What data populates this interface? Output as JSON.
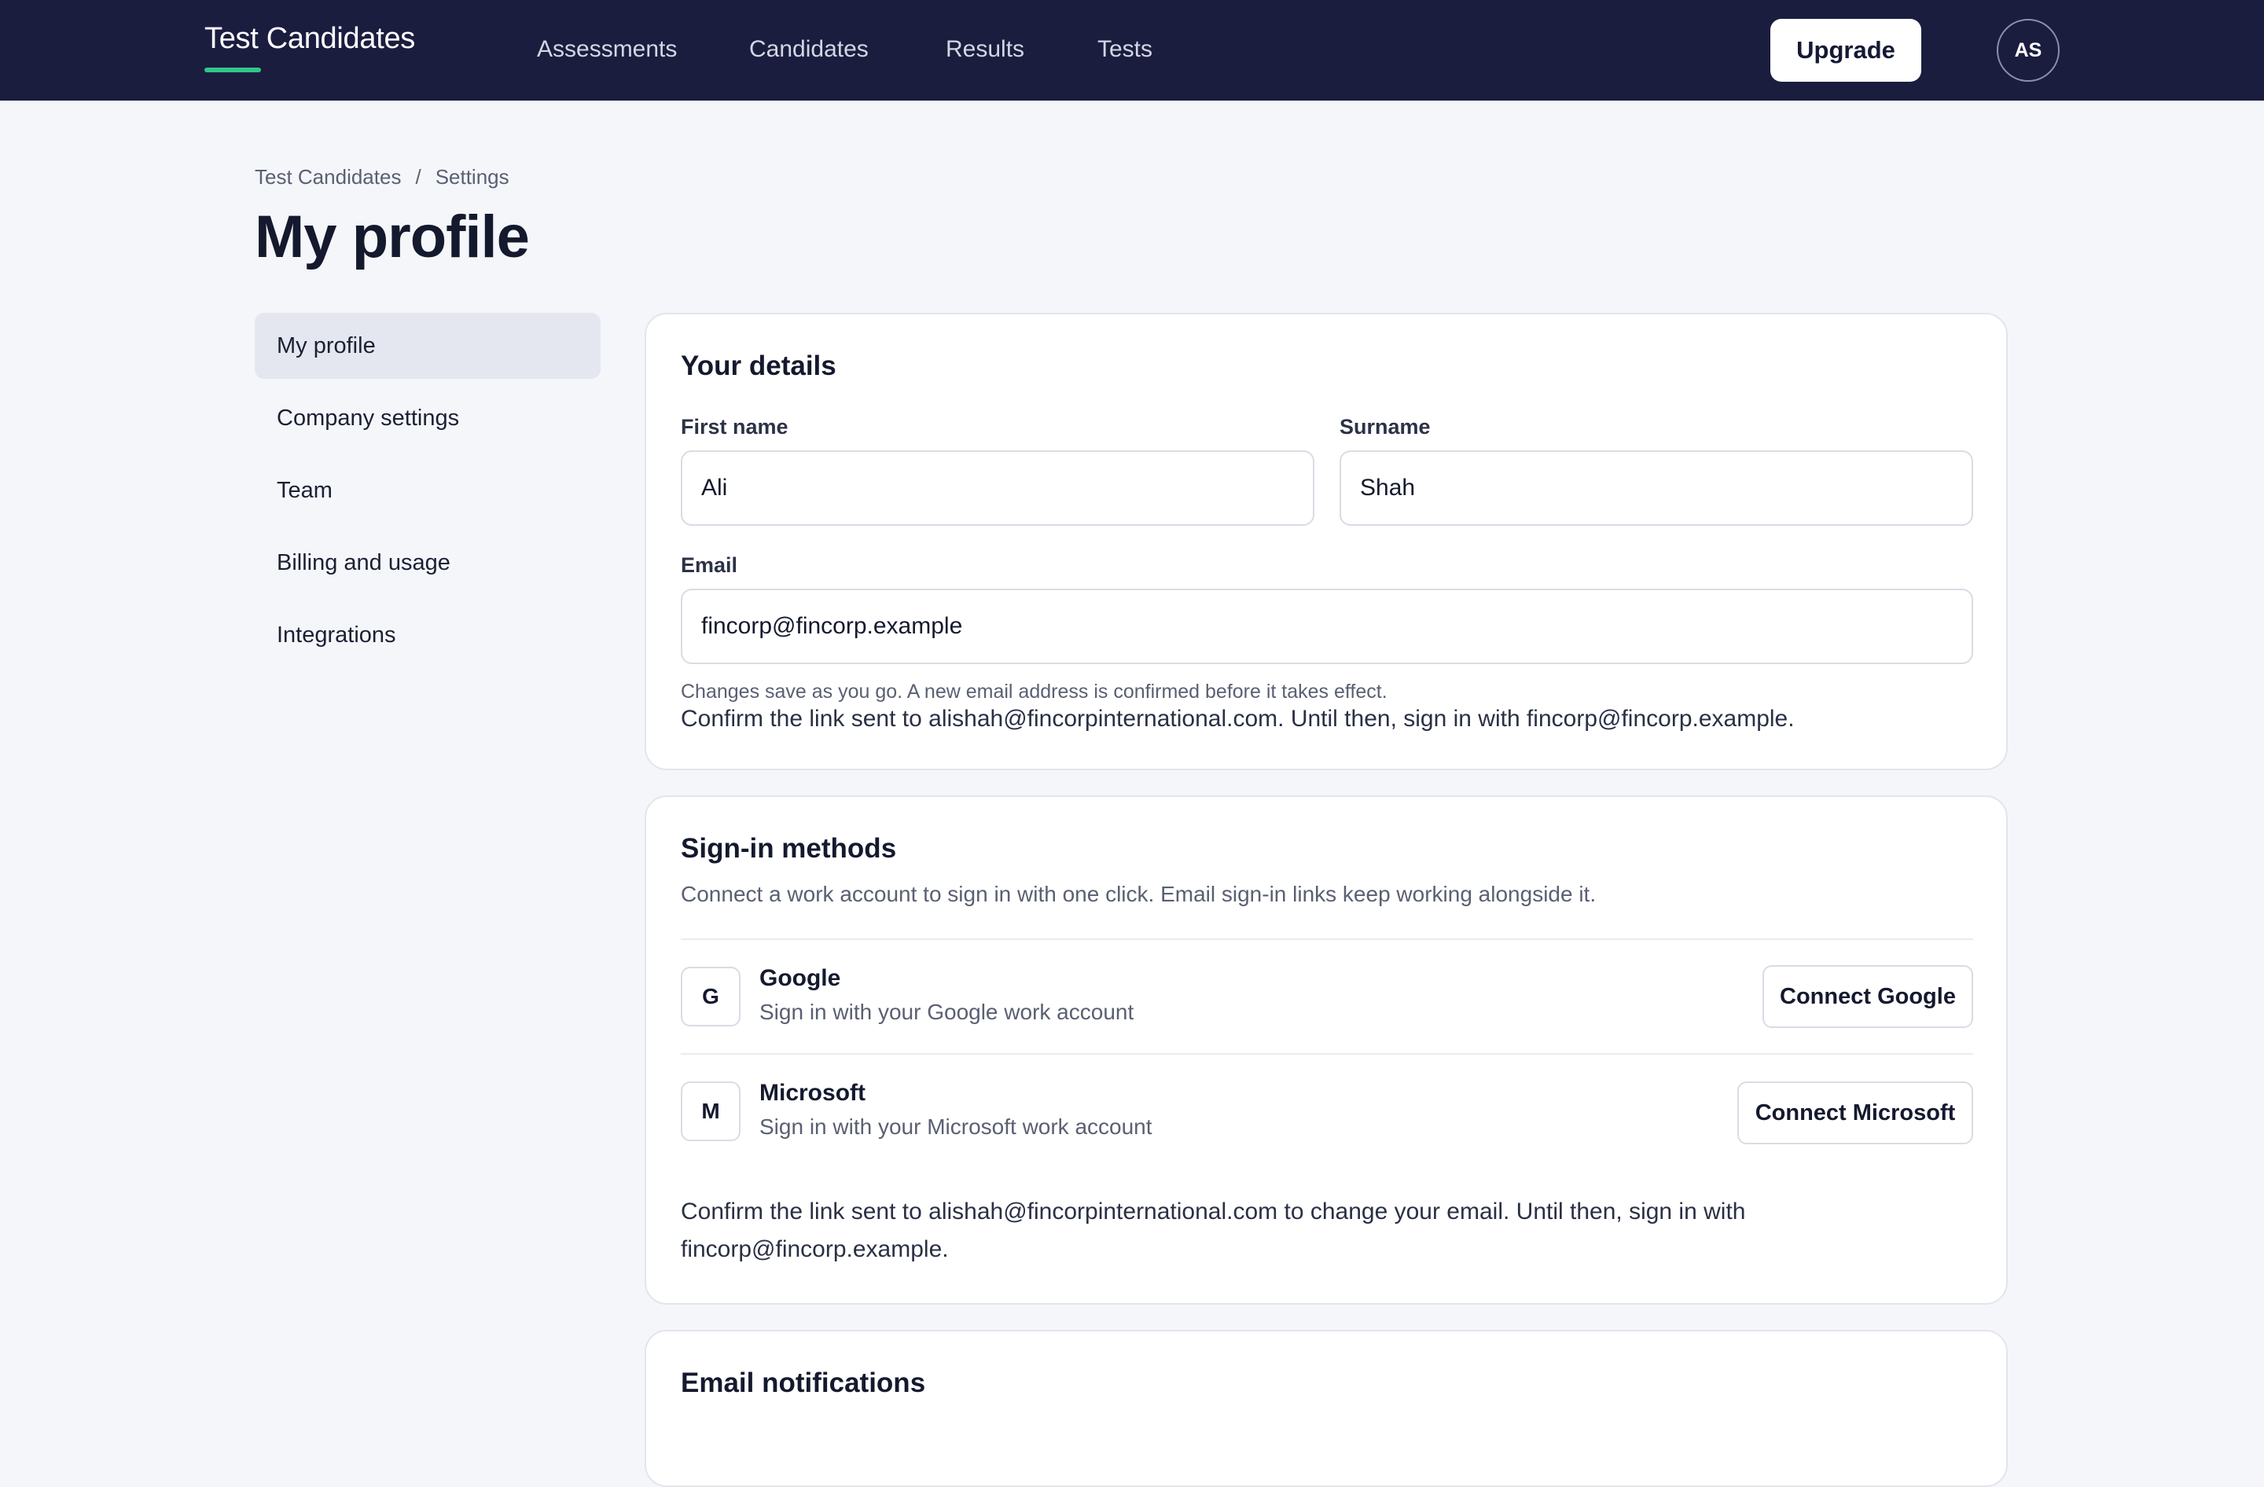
{
  "header": {
    "brand": "Test Candidates",
    "nav": [
      "Assessments",
      "Candidates",
      "Results",
      "Tests"
    ],
    "upgrade_label": "Upgrade",
    "avatar_initials": "AS"
  },
  "breadcrumb": {
    "root": "Test Candidates",
    "separator": "/",
    "current": "Settings"
  },
  "page_title": "My profile",
  "sidebar": {
    "items": [
      {
        "label": "My profile",
        "active": true
      },
      {
        "label": "Company settings",
        "active": false
      },
      {
        "label": "Team",
        "active": false
      },
      {
        "label": "Billing and usage",
        "active": false
      },
      {
        "label": "Integrations",
        "active": false
      }
    ]
  },
  "details": {
    "title": "Your details",
    "first_name_label": "First name",
    "first_name_value": "Ali",
    "surname_label": "Surname",
    "surname_value": "Shah",
    "email_label": "Email",
    "email_value": "fincorp@fincorp.example",
    "help_text": "Changes save as you go. A new email address is confirmed before it takes effect.",
    "pending_text": "Confirm the link sent to alishah@fincorpinternational.com. Until then, sign in with fincorp@fincorp.example."
  },
  "signin": {
    "title": "Sign-in methods",
    "subtitle": "Connect a work account to sign in with one click. Email sign-in links keep working alongside it.",
    "providers": [
      {
        "icon_letter": "G",
        "name": "Google",
        "desc": "Sign in with your Google work account",
        "button": "Connect Google"
      },
      {
        "icon_letter": "M",
        "name": "Microsoft",
        "desc": "Sign in with your Microsoft work account",
        "button": "Connect Microsoft"
      }
    ],
    "note": "Confirm the link sent to alishah@fincorpinternational.com to change your email. Until then, sign in with fincorp@fincorp.example."
  },
  "notifications": {
    "title": "Email notifications"
  },
  "colors": {
    "topbar": "#1b1d3f",
    "accent": "#33c58a",
    "page_bg": "#f4f6fa"
  }
}
